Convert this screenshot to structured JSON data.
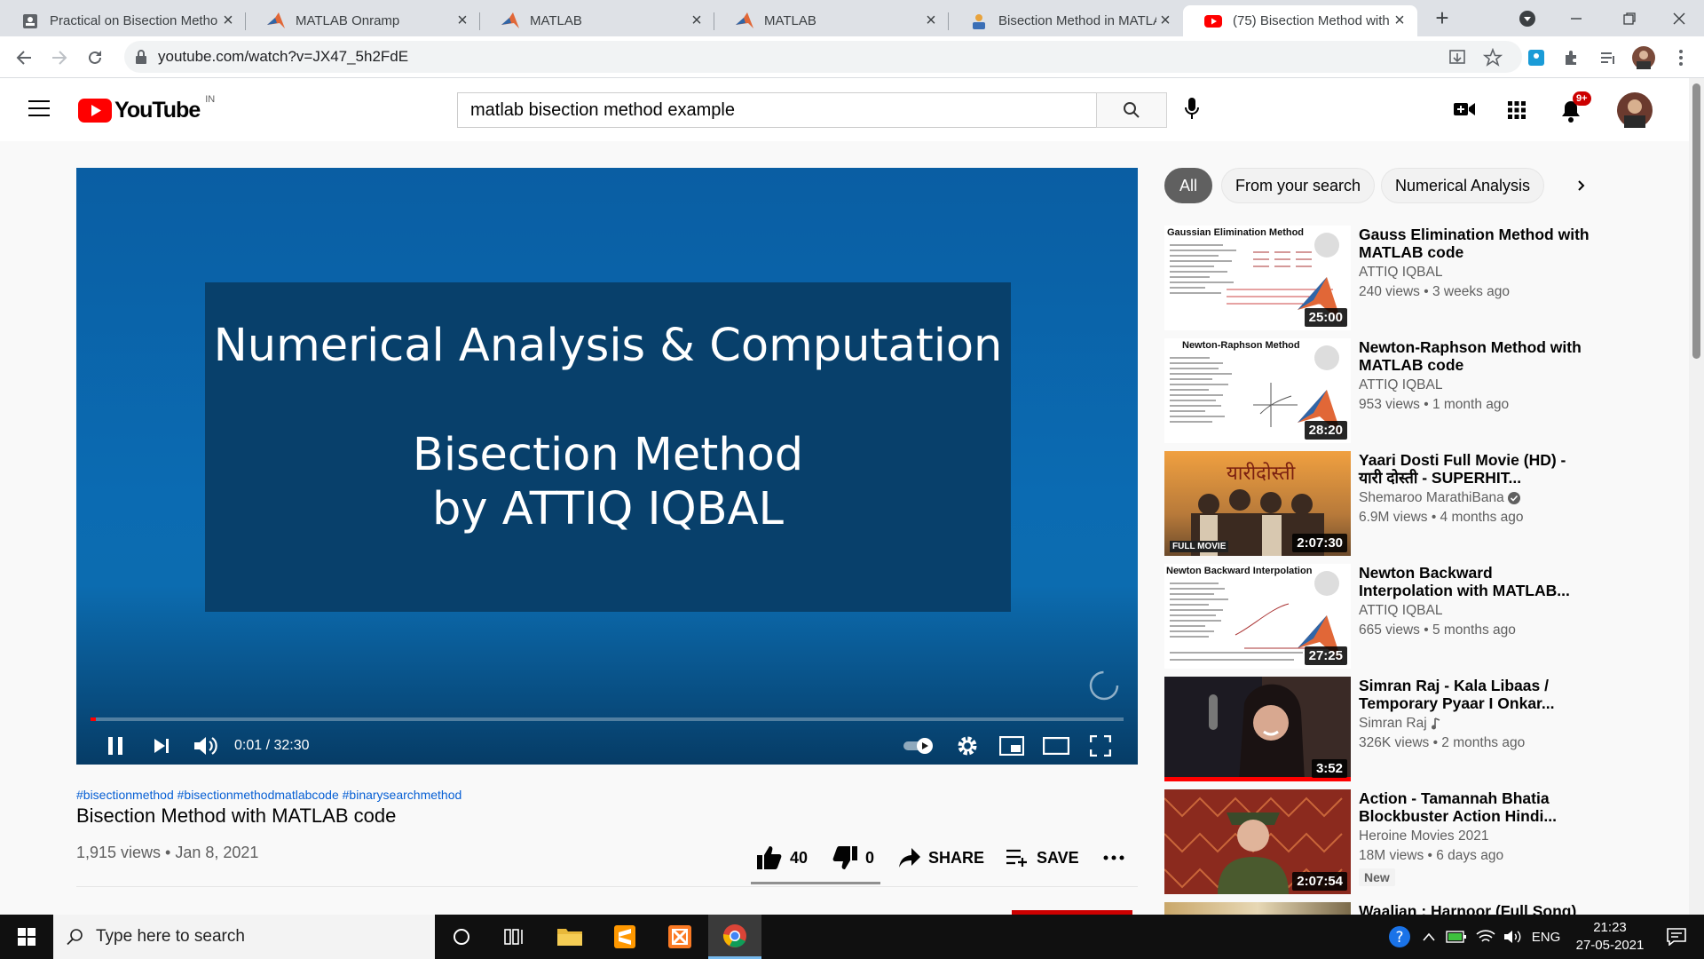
{
  "browser": {
    "tabs": [
      {
        "title": "Practical on Bisection Metho",
        "icon": "document-icon"
      },
      {
        "title": "MATLAB Onramp",
        "icon": "matlab-icon"
      },
      {
        "title": "MATLAB",
        "icon": "matlab-icon"
      },
      {
        "title": "MATLAB",
        "icon": "matlab-icon"
      },
      {
        "title": "Bisection Method in MATLA",
        "icon": "mathworks-icon"
      },
      {
        "title": "(75) Bisection Method with",
        "icon": "youtube-icon"
      }
    ],
    "url": "youtube.com/watch?v=JX47_5h2FdE"
  },
  "youtube": {
    "logo_text": "YouTube",
    "region": "IN",
    "search_query": "matlab bisection method example",
    "notification_count": "9+"
  },
  "video": {
    "slide_line1": "Numerical Analysis & Computation",
    "slide_line2": "Bisection Method",
    "slide_line3": "by ATTIQ IQBAL",
    "time": "0:01 / 32:30",
    "progress": 0.0005,
    "hashtags": "#bisectionmethod #bisectionmethodmatlabcode #binarysearchmethod",
    "title": "Bisection Method with MATLAB code",
    "meta": "1,915 views • Jan 8, 2021",
    "likes": "40",
    "dislikes": "0",
    "share_label": "SHARE",
    "save_label": "SAVE"
  },
  "chips": [
    "All",
    "From your search",
    "Numerical Analysis"
  ],
  "recommendations": [
    {
      "title": "Gauss Elimination Method with MATLAB code",
      "channel": "ATTIQ IQBAL",
      "views": "240 views • 3 weeks ago",
      "duration": "25:00",
      "thumb_caption": "Gaussian Elimination Method",
      "verified": false,
      "music": false,
      "new": ""
    },
    {
      "title": "Newton-Raphson Method with MATLAB code",
      "channel": "ATTIQ IQBAL",
      "views": "953 views • 1 month ago",
      "duration": "28:20",
      "thumb_caption": "Newton-Raphson Method",
      "verified": false,
      "music": false,
      "new": ""
    },
    {
      "title": "Yaari Dosti Full Movie (HD) - यारी दोस्ती - SUPERHIT...",
      "channel": "Shemaroo MarathiBana",
      "views": "6.9M views • 4 months ago",
      "duration": "2:07:30",
      "thumb_caption": "FULL MOVIE",
      "verified": true,
      "music": false,
      "new": ""
    },
    {
      "title": "Newton Backward Interpolation with MATLAB...",
      "channel": "ATTIQ IQBAL",
      "views": "665 views • 5 months ago",
      "duration": "27:25",
      "thumb_caption": "Newton Backward Interpolation",
      "verified": false,
      "music": false,
      "new": ""
    },
    {
      "title": "Simran Raj - Kala Libaas / Temporary Pyaar I Onkar...",
      "channel": "Simran Raj",
      "views": "326K views • 2 months ago",
      "duration": "3:52",
      "thumb_caption": "",
      "verified": false,
      "music": true,
      "new": ""
    },
    {
      "title": "Action - Tamannah Bhatia Blockbuster Action Hindi...",
      "channel": "Heroine Movies 2021",
      "views": "18M views • 6 days ago",
      "duration": "2:07:54",
      "thumb_caption": "",
      "verified": false,
      "music": false,
      "new": "New"
    },
    {
      "title": "Waalian : Harnoor (Full Song)",
      "channel": "",
      "views": "",
      "duration": "",
      "thumb_caption": "",
      "verified": false,
      "music": false,
      "new": ""
    }
  ],
  "taskbar": {
    "search_placeholder": "Type here to search",
    "language": "ENG",
    "time": "21:23",
    "date": "27-05-2021"
  }
}
